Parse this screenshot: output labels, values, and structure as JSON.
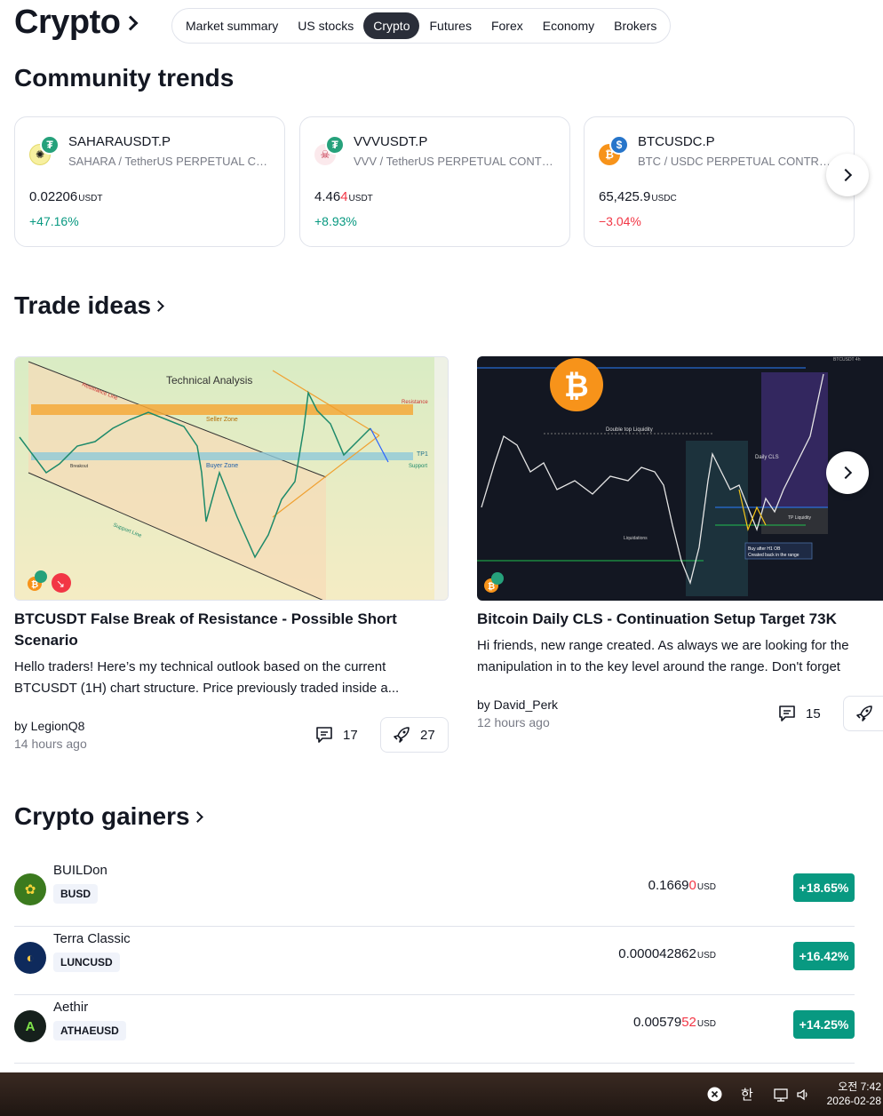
{
  "header": {
    "title": "Crypto",
    "tabs": [
      "Market summary",
      "US stocks",
      "Crypto",
      "Futures",
      "Forex",
      "Economy",
      "Brokers"
    ],
    "active_tab": "Crypto"
  },
  "community_trends": {
    "title": "Community trends",
    "cards": [
      {
        "symbol": "SAHARAUSDT.P",
        "description": "SAHARA / TetherUS PERPETUAL CONTRACT",
        "price": "0.02206",
        "unit": "USDT",
        "change": "+47.16%",
        "direction": "up"
      },
      {
        "symbol": "VVVUSDT.P",
        "description": "VVV / TetherUS PERPETUAL CONTRACT",
        "price_main": "4.46",
        "price_tail": "4",
        "unit": "USDT",
        "change": "+8.93%",
        "direction": "up"
      },
      {
        "symbol": "BTCUSDC.P",
        "description": "BTC / USDC PERPETUAL CONTRACT",
        "price": "65,425.9",
        "unit": "USDC",
        "change": "−3.04%",
        "direction": "down"
      }
    ]
  },
  "trade_ideas": {
    "title": "Trade ideas",
    "items": [
      {
        "title": "BTCUSDT False Break of Resistance - Possible Short Scenario",
        "description": "Hello traders! Here’s my technical outlook based on the current BTCUSDT (1H) chart structure. Price previously traded inside a...",
        "author": "by LegionQ8",
        "time": "14 hours ago",
        "comments": "17",
        "boosts": "27",
        "chart_labels": {
          "heading": "Technical Analysis",
          "resistance": "Resistance",
          "seller_zone": "Seller Zone",
          "buyer_zone": "Buyer Zone",
          "tp1": "TP1",
          "support": "Support",
          "resistance_line": "Resistance Line",
          "support_line": "Support Line",
          "breakout": "Breakout"
        }
      },
      {
        "title": "Bitcoin Daily CLS - Continuation Setup Target 73K",
        "description": "Hi friends, new range created. As always we are looking for the manipulation in to the key level around the range. Don't forget confirmation switch from manipulation phase to the distribution",
        "author": "by David_Perk",
        "time": "12 hours ago",
        "comments": "15",
        "chart_labels": {
          "top": "Double top Liquidity",
          "daily": "Daily CLS",
          "liq": "Liquidations",
          "buy": "Buy after H1 OB",
          "buy2": "Created back in the range",
          "tp": "TP Liquidity",
          "corner": "BTCUSDT 4h"
        }
      }
    ]
  },
  "crypto_gainers": {
    "title": "Crypto gainers",
    "rows": [
      {
        "name": "BUILDon",
        "ticker": "BUSD",
        "price_main": "0.1669",
        "price_tail": "0",
        "unit": "USD",
        "change": "+18.65%"
      },
      {
        "name": "Terra Classic",
        "ticker": "LUNCUSD",
        "price_main": "0.000042862",
        "price_tail": "",
        "unit": "USD",
        "change": "+16.42%"
      },
      {
        "name": "Aethir",
        "ticker": "ATHAEUSD",
        "price_main": "0.00579",
        "price_tail": "52",
        "unit": "USD",
        "change": "+14.25%"
      }
    ]
  },
  "taskbar": {
    "ime": "한",
    "time": "오전 7:42",
    "date": "2026-02-28"
  }
}
